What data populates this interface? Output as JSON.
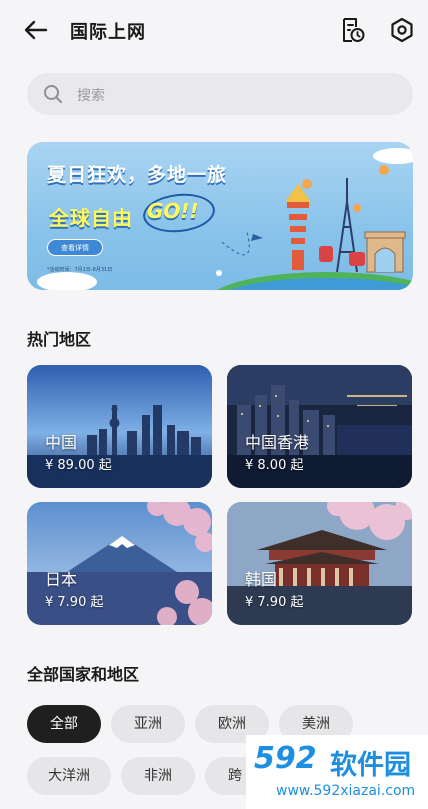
{
  "header": {
    "title": "国际上网",
    "back_icon": "arrow-left-icon",
    "history_icon": "order-history-icon",
    "settings_icon": "settings-hexagon-icon"
  },
  "search": {
    "placeholder": "搜索"
  },
  "banner": {
    "line1": "夏日狂欢，多地一旅",
    "line2": "全球自由",
    "go": "GO!!",
    "button": "查看详情",
    "note": "*活动时间：7月1日-8月31日"
  },
  "hot": {
    "title": "热门地区",
    "cards": [
      {
        "name": "中国",
        "price": "¥ 89.00 起"
      },
      {
        "name": "中国香港",
        "price": "¥ 8.00 起"
      },
      {
        "name": "日本",
        "price": "¥ 7.90 起"
      },
      {
        "name": "韩国",
        "price": "¥ 7.90 起"
      }
    ]
  },
  "all": {
    "title": "全部国家和地区",
    "chips": [
      "全部",
      "亚洲",
      "欧洲",
      "美洲",
      "大洋洲",
      "非洲",
      "跨"
    ],
    "selected": "全部"
  },
  "watermark": {
    "logo": "592",
    "name": "软件园",
    "url": "www.592xiazai.com"
  },
  "colors": {
    "accent": "#1f1f1f",
    "background": "#f5f5f7",
    "chip": "#e6e6e9",
    "watermark": "#1e8fe0"
  }
}
